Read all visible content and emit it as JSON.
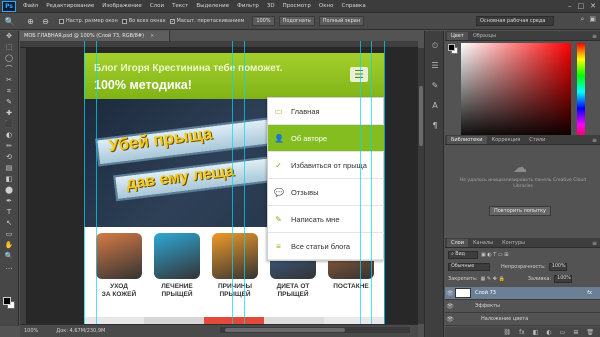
{
  "app": {
    "logo": "Ps"
  },
  "menu": [
    "Файл",
    "Редактирование",
    "Изображение",
    "Слои",
    "Текст",
    "Выделение",
    "Фильтр",
    "3D",
    "Просмотр",
    "Окно",
    "Справка"
  ],
  "window_controls": {
    "minimize": "–",
    "maximize": "□",
    "close": "✕"
  },
  "options": {
    "tool_icon": "🔍",
    "zoom_in": "⊕",
    "zoom_out": "⊖",
    "check1": "Настр. размер окон",
    "check2": "Во всех окнах",
    "check3": "Масшт. перетаскиванием",
    "btn100": "100%",
    "btn_fit": "Подогнать",
    "btn_fullscreen": "Полный экран",
    "workspace": "Основная рабочая среда"
  },
  "tools": [
    "✥",
    "⬚",
    "◯",
    "⌒",
    "✂",
    "⌗",
    "✎",
    "✚",
    "⬛",
    "◐",
    "✏",
    "⟲",
    "▤",
    "◧",
    "⬤",
    "✒",
    "T",
    "↖",
    "▭",
    "✋",
    "🔍",
    "…"
  ],
  "document": {
    "tab": "МОБ ГЛАВНАЯ.psd @ 100% (Слой 73, RGB/8#)",
    "close": "×",
    "header_line1": "Блог Игоря Крестинина тебе поможет.",
    "header_line2": "100% методика!",
    "burger": "☰",
    "banner_line1": "Убей прыща",
    "banner_line2": "дав ему леща",
    "menu": [
      {
        "icon": "▭",
        "label": "Главная",
        "active": false
      },
      {
        "icon": "👤",
        "label": "Об авторе",
        "active": true
      },
      {
        "icon": "✓",
        "label": "Избавиться от прыща",
        "active": false
      },
      {
        "icon": "💬",
        "label": "Отзывы",
        "active": false
      },
      {
        "icon": "✎",
        "label": "Написать мне",
        "active": false
      },
      {
        "icon": "≡",
        "label": "Все статьи блога",
        "active": false
      }
    ],
    "cards": [
      {
        "label": "УХОД\nЗА КОЖЕЙ",
        "color": "#d77b45"
      },
      {
        "label": "ЛЕЧЕНИЕ\nПРЫЩЕЙ",
        "color": "#2ea8d8"
      },
      {
        "label": "ПРИЧИНЫ\nПРЫЩЕЙ",
        "color": "#f09a2a"
      },
      {
        "label": "ДИЕТА ОТ\nПРЫЩЕЙ",
        "color": "#3e6ca6"
      },
      {
        "label": "ПОСТАКНЕ",
        "color": "#b56b3a"
      }
    ]
  },
  "status": {
    "zoom": "100%",
    "doc": "Док: 4,67М/230,9М"
  },
  "panels": {
    "color_tabs": [
      "Цвет",
      "Образцы"
    ],
    "library_tabs": [
      "Библиотеки",
      "Коррекция",
      "Стили"
    ],
    "library_text": "Не удалось инициализировать панель Creative Cloud Libraries",
    "library_button": "Повторить попытку",
    "layer_tabs": [
      "Слои",
      "Каналы",
      "Контуры"
    ],
    "kind": "Вид",
    "blend": "Обычные",
    "opacity_label": "Непрозрачность:",
    "opacity": "100%",
    "lock_label": "Закрепить:",
    "fill_label": "Заливка:",
    "fill": "100%",
    "layers": [
      {
        "name": "Слой 73",
        "fx": "fx",
        "sel": true,
        "eye": true
      },
      {
        "name": "Эффекты",
        "fx": "",
        "sel": false,
        "eye": true
      },
      {
        "name": "Наложение цвета",
        "fx": "",
        "sel": false,
        "eye": true
      }
    ],
    "footer_icons": [
      "⛓",
      "fx",
      "◧",
      "◐",
      "▭",
      "⊞",
      "🗑"
    ]
  }
}
